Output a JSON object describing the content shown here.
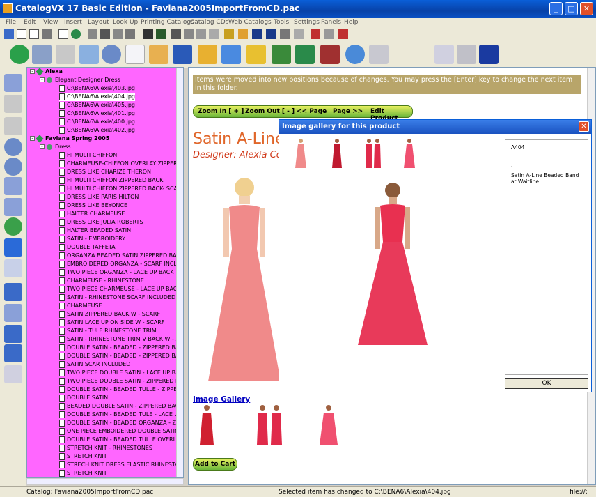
{
  "window": {
    "title": "CatalogVX 17 Basic Edition - Faviana2005ImportFromCD.pac",
    "minimize": "_",
    "maximize": "□",
    "close": "✕"
  },
  "menu": [
    "File",
    "Edit",
    "View",
    "Insert",
    "Layout",
    "Look Up",
    "Printing Catalogs",
    "Catalog CDs",
    "Web Catalogs",
    "Tools",
    "Settings",
    "Panels",
    "Help"
  ],
  "tree": {
    "root1": "Alexa",
    "folder1": "Elegant Designer Dress",
    "files": [
      "C:\\BENA6\\Alexia\\403.jpg",
      "C:\\BENA6\\Alexia\\404.jpg",
      "C:\\BENA6\\Alexia\\405.jpg",
      "C:\\BENA6\\Alexia\\401.jpg",
      "C:\\BENA6\\Alexia\\400.jpg",
      "C:\\BENA6\\Alexia\\402.jpg"
    ],
    "root2": "Faviana Spring 2005",
    "folder2": "Dress",
    "items": [
      "HI MULTI CHIFFON",
      "CHARMEUSE-CHIFFON OVERLAY ZIPPERE",
      "DRESS LIKE CHARIZE THERON",
      "HI MULTI CHIFFON ZIPPERED BACK",
      "HI MULTI CHIFFON ZIPPERED BACK- SCAR",
      "DRESS LIKE PARIS HILTON",
      "DRESS LIKE BEYONCE",
      "HALTER CHARMEUSE",
      "DRESS LIKE JULIA ROBERTS",
      "HALTER BEADED SATIN",
      "SATIN -  EMBROIDERY",
      "DOUBLE TAFFETA",
      "ORGANZA BEADED SATIN ZIPPERED BACK",
      "EMBROIDERED ORGANZA  -  SCARF INCLU",
      "TWO PIECE ORGANZA  -  LACE UP BACK",
      "CHARMEUSE - RHINESTONE",
      "TWO PIECE CHARMEUSE - LACE UP BACK",
      "SATIN - RHINESTONE SCARF INCLUDED",
      "CHARMEUSE",
      "SATIN ZIPPERED BACK W - SCARF",
      "SATIN LACE UP ON SIDE W - SCARF",
      "SATIN  - TULE RHINESTONE TRIM",
      "SATIN - RHINESTONE TRIM V BACK W - ZI",
      "DOUBLE SATIN - BEADED -  ZIPPERED BAC",
      "DOUBLE SATIN - BEADED -  ZIPPERED BAC",
      "SATIN SCAR INCLUDED",
      "TWO PIECE DOUBLE SATIN - LACE UP BAC",
      "TWO PIECE DOUBLE SATIN - ZIPPERED BA",
      "DOUBLE SATIN - BEADED TULLE - ZIPPERE",
      "DOUBLE SATIN",
      "BEADED DOUBLE SATIN - ZIPPERED BACK",
      "DOUBLE SATIN - BEADED TULE - LACE UP",
      "DOUBLE SATIN - BEADED ORGANZA  - ZIP",
      "ONE PIECE EMBOIDERED DOUBLE SATIN",
      "DOUBLE SATIN - BEADED TULLE OVERLAY",
      "STRETCH KNIT - RHINESTONES",
      "STRETCH KNIT",
      "STRECH KNIT DRESS ELASTIC RHINESTON",
      "STRETCH KNIT"
    ]
  },
  "main": {
    "notice": "Items were moved into new positions because of changes. You may press the [Enter] key to change the next item in this folder.",
    "zoom_in": "Zoom In [ + ]",
    "zoom_out": "Zoom Out [ - ]",
    "prev_page": "<< Page",
    "next_page": "Page >>",
    "edit_product": "Edit Product",
    "title": "Satin A-Line",
    "designer": "Designer: Alexia Co",
    "gallery_link": "Image Gallery",
    "add_to_cart": "Add to Cart"
  },
  "dialog": {
    "title": "Image gallery for this product",
    "close": "✕",
    "sku": "A404",
    "dot": ".",
    "description": "Satin A-Line Beaded Band at Waitline",
    "ok": "OK"
  },
  "status": {
    "catalog": "Catalog: Faviana2005ImportFromCD.pac",
    "message": "Selected item has changed to C:\\BENA6\\Alexia\\404.jpg",
    "file": "file://:"
  },
  "colors": {
    "tree_bg": "#ff66ff",
    "notice_bg": "#b8a56a",
    "title_orange": "#e0662a",
    "dress_pink": "#f08a8a",
    "dress_red": "#e02a4a"
  }
}
